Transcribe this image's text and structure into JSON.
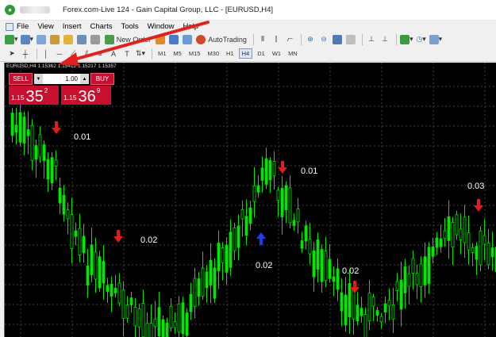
{
  "window": {
    "title": "Forex.com-Live 124 - Gain Capital Group, LLC - [EURUSD,H4]"
  },
  "menu": {
    "items": [
      "File",
      "View",
      "Insert",
      "Charts",
      "Tools",
      "Window",
      "Help"
    ]
  },
  "toolbar": {
    "new_order_label": "New Order",
    "autotrading_label": "AutoTrading",
    "timeframes": [
      "M1",
      "M5",
      "M15",
      "M30",
      "H1",
      "H4",
      "D1",
      "W1",
      "MN"
    ],
    "active_timeframe": "H4"
  },
  "chart": {
    "header": "EURUSD,H4  1.15362 1.15412 1.15217 1.15357",
    "background": "#000000",
    "candle_color": "#00e600",
    "grid_color": "#404040"
  },
  "trade_panel": {
    "sell_label": "SELL",
    "buy_label": "BUY",
    "lot_value": "1.00",
    "sell_price_prefix": "1.15",
    "sell_price_big": "35",
    "sell_price_sup": "2",
    "buy_price_prefix": "1.15",
    "buy_price_big": "36",
    "buy_price_sup": "9",
    "color": "#c8102e"
  },
  "annotations": [
    {
      "type": "sell-arrow",
      "label": "0.01",
      "color": "#e31b1b"
    },
    {
      "type": "sell-arrow",
      "label": "0.02",
      "color": "#e31b1b"
    },
    {
      "type": "sell-arrow",
      "label": "0.01",
      "color": "#e31b1b"
    },
    {
      "type": "buy-arrow",
      "label": "0.02",
      "color": "#1f3fe6"
    },
    {
      "type": "sell-arrow",
      "label": "0.02",
      "color": "#e31b1b"
    },
    {
      "type": "sell-arrow",
      "label": "0.03",
      "color": "#e31b1b"
    }
  ]
}
